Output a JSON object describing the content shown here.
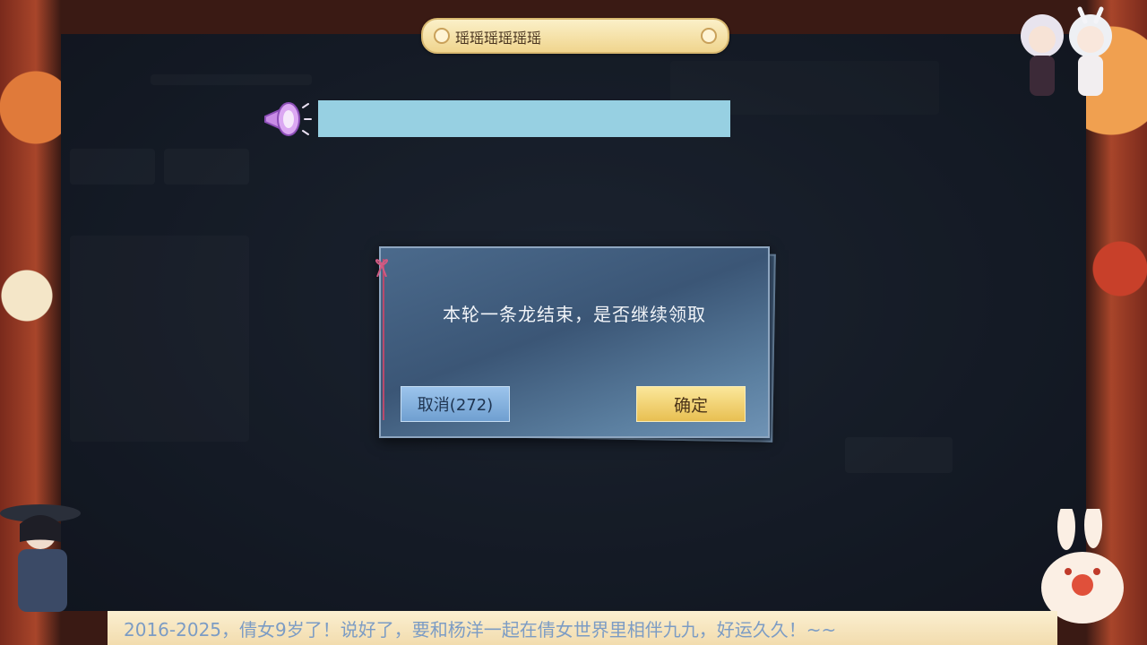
{
  "title_plate": {
    "text": "瑶瑶瑶瑶瑶瑶"
  },
  "announcement": {
    "text": ""
  },
  "dialog": {
    "message": "本轮一条龙结束，是否继续领取",
    "cancel_label": "取消(272)",
    "confirm_label": "确定"
  },
  "banner": {
    "text": "2016-2025，倩女9岁了！说好了，要和杨洋一起在倩女世界里相伴九九，好运久久！~~"
  },
  "colors": {
    "announce_bar": "#97d0e2",
    "confirm_button": "#f0cd68",
    "cancel_button": "#85b2de",
    "dialog_body": "#4b6a8c"
  },
  "icons": [
    "megaphone-icon",
    "ribbon-knot-icon",
    "lantern-icon"
  ]
}
